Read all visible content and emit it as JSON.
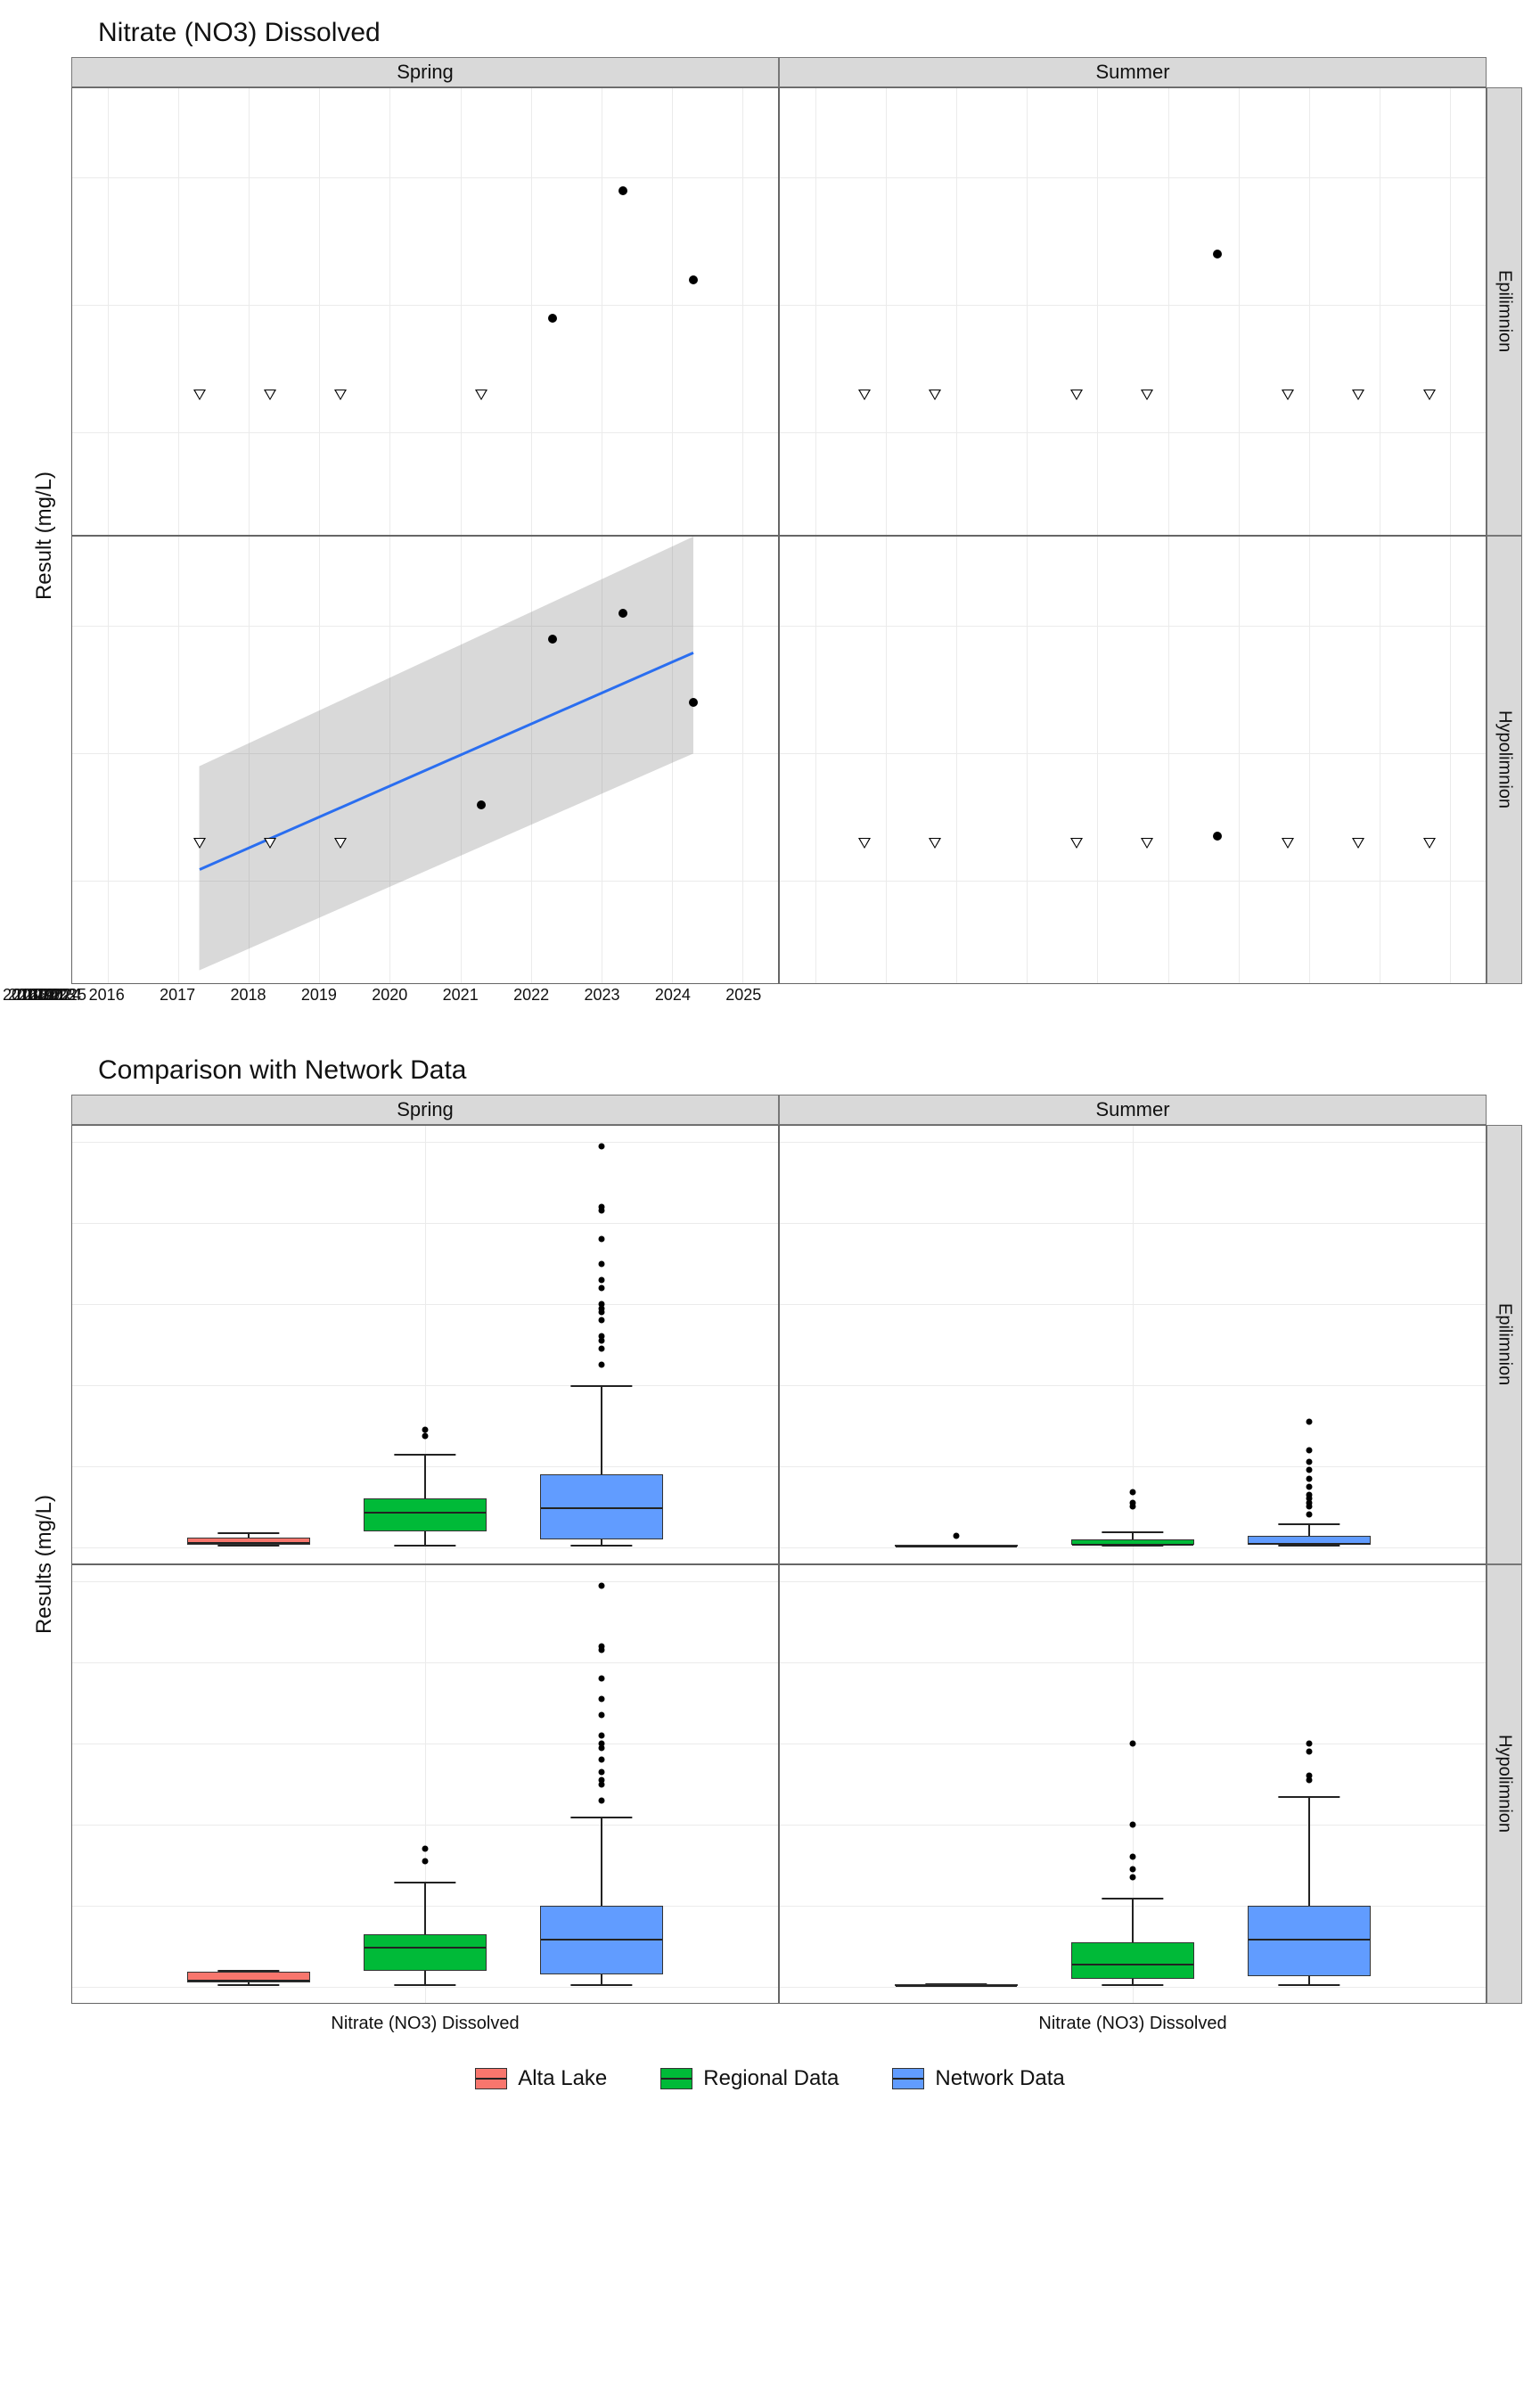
{
  "chart_data": [
    {
      "type": "scatter",
      "title": "Nitrate (NO3) Dissolved",
      "ylabel": "Result (mg/L)",
      "xlabel": "",
      "facet_cols": [
        "Spring",
        "Summer"
      ],
      "facet_rows": [
        "Epilimnion",
        "Hypolimnion"
      ],
      "x_ticks": [
        2016,
        2017,
        2018,
        2019,
        2020,
        2021,
        2022,
        2023,
        2024,
        2025
      ],
      "y_ticks": [
        0.0,
        0.01,
        0.02
      ],
      "censor_value": 0.003,
      "panels": {
        "Spring|Epilimnion": {
          "censored_x": [
            2017.3,
            2018.3,
            2019.3,
            2021.3
          ],
          "points": [
            {
              "x": 2022.3,
              "y": 0.009
            },
            {
              "x": 2023.3,
              "y": 0.019
            },
            {
              "x": 2024.3,
              "y": 0.012
            }
          ]
        },
        "Summer|Epilimnion": {
          "censored_x": [
            2016.7,
            2017.7,
            2019.7,
            2020.7,
            2022.7,
            2023.7,
            2024.7
          ],
          "points": [
            {
              "x": 2021.7,
              "y": 0.014
            }
          ]
        },
        "Spring|Hypolimnion": {
          "censored_x": [
            2017.3,
            2018.3,
            2019.3
          ],
          "points": [
            {
              "x": 2021.3,
              "y": 0.006
            },
            {
              "x": 2022.3,
              "y": 0.019
            },
            {
              "x": 2023.3,
              "y": 0.021
            },
            {
              "x": 2024.3,
              "y": 0.014
            }
          ],
          "trend": {
            "x0": 2017.3,
            "y0": 0.001,
            "x1": 2024.3,
            "y1": 0.018
          },
          "ribbon": {
            "x0": 2017.3,
            "x1": 2024.3,
            "y0_low": -0.007,
            "y0_high": 0.009,
            "y1_low": 0.01,
            "y1_high": 0.027
          }
        },
        "Summer|Hypolimnion": {
          "censored_x": [
            2016.7,
            2017.7,
            2019.7,
            2020.7,
            2022.7,
            2023.7,
            2024.7
          ],
          "points": [
            {
              "x": 2021.7,
              "y": 0.0035
            }
          ]
        }
      }
    },
    {
      "type": "box",
      "title": "Comparison with Network Data",
      "ylabel": "Results (mg/L)",
      "xlabel": "Nitrate (NO3) Dissolved",
      "facet_cols": [
        "Spring",
        "Summer"
      ],
      "facet_rows": [
        "Epilimnion",
        "Hypolimnion"
      ],
      "y_ticks": [
        0.0,
        0.1,
        0.2,
        0.3,
        0.4,
        0.5
      ],
      "groups": [
        "Alta Lake",
        "Regional Data",
        "Network Data"
      ],
      "colors": {
        "Alta Lake": "#F8766D",
        "Regional Data": "#00BA38",
        "Network Data": "#619CFF"
      },
      "panels": {
        "Spring|Epilimnion": {
          "Alta Lake": {
            "min": 0.003,
            "q1": 0.003,
            "med": 0.007,
            "q3": 0.012,
            "max": 0.019,
            "out": []
          },
          "Regional Data": {
            "min": 0.003,
            "q1": 0.02,
            "med": 0.045,
            "q3": 0.06,
            "max": 0.115,
            "out": [
              0.137,
              0.145
            ]
          },
          "Network Data": {
            "min": 0.003,
            "q1": 0.01,
            "med": 0.05,
            "q3": 0.09,
            "max": 0.2,
            "out": [
              0.225,
              0.245,
              0.255,
              0.26,
              0.28,
              0.29,
              0.295,
              0.3,
              0.32,
              0.33,
              0.35,
              0.38,
              0.415,
              0.42,
              0.495
            ]
          }
        },
        "Summer|Epilimnion": {
          "Alta Lake": {
            "min": 0.003,
            "q1": 0.003,
            "med": 0.003,
            "q3": 0.003,
            "max": 0.003,
            "out": [
              0.014
            ]
          },
          "Regional Data": {
            "min": 0.003,
            "q1": 0.003,
            "med": 0.005,
            "q3": 0.01,
            "max": 0.02,
            "out": [
              0.05,
              0.055,
              0.068
            ]
          },
          "Network Data": {
            "min": 0.003,
            "q1": 0.003,
            "med": 0.006,
            "q3": 0.014,
            "max": 0.03,
            "out": [
              0.04,
              0.05,
              0.055,
              0.06,
              0.065,
              0.075,
              0.085,
              0.095,
              0.105,
              0.12,
              0.155
            ]
          }
        },
        "Spring|Hypolimnion": {
          "Alta Lake": {
            "min": 0.003,
            "q1": 0.005,
            "med": 0.01,
            "q3": 0.018,
            "max": 0.021,
            "out": []
          },
          "Regional Data": {
            "min": 0.003,
            "q1": 0.02,
            "med": 0.05,
            "q3": 0.065,
            "max": 0.13,
            "out": [
              0.155,
              0.17
            ]
          },
          "Network Data": {
            "min": 0.003,
            "q1": 0.015,
            "med": 0.06,
            "q3": 0.1,
            "max": 0.21,
            "out": [
              0.23,
              0.25,
              0.255,
              0.265,
              0.28,
              0.295,
              0.3,
              0.31,
              0.335,
              0.355,
              0.38,
              0.415,
              0.42,
              0.495
            ]
          }
        },
        "Summer|Hypolimnion": {
          "Alta Lake": {
            "min": 0.003,
            "q1": 0.003,
            "med": 0.003,
            "q3": 0.003,
            "max": 0.004,
            "out": []
          },
          "Regional Data": {
            "min": 0.003,
            "q1": 0.01,
            "med": 0.03,
            "q3": 0.055,
            "max": 0.11,
            "out": [
              0.135,
              0.145,
              0.16,
              0.2,
              0.3
            ]
          },
          "Network Data": {
            "min": 0.003,
            "q1": 0.013,
            "med": 0.06,
            "q3": 0.1,
            "max": 0.235,
            "out": [
              0.255,
              0.26,
              0.29,
              0.3
            ]
          }
        }
      }
    }
  ],
  "legend": {
    "items": [
      "Alta Lake",
      "Regional Data",
      "Network Data"
    ]
  }
}
